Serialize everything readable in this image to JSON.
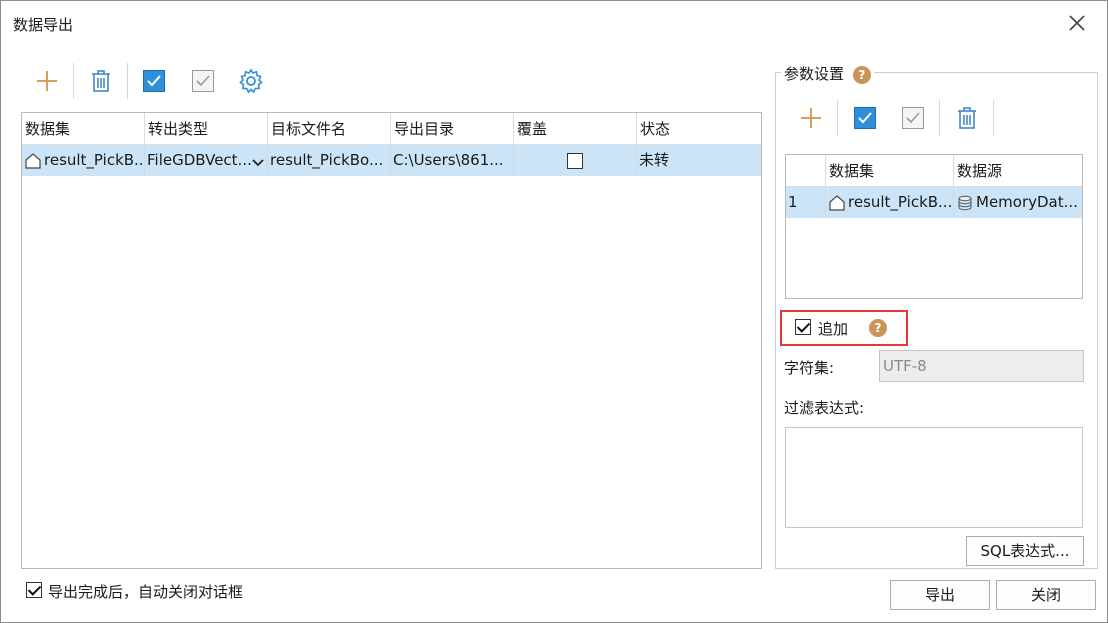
{
  "window": {
    "title": "数据导出"
  },
  "toolbar": {
    "add": "add-icon",
    "delete": "trash-icon",
    "select_all": "check-all-icon",
    "select_invert": "check-invert-icon",
    "settings": "gear-icon"
  },
  "table": {
    "columns": [
      "数据集",
      "转出类型",
      "目标文件名",
      "导出目录",
      "覆盖",
      "状态"
    ],
    "rows": [
      {
        "dataset": "result_PickB...",
        "type": "FileGDBVect...",
        "filename": "result_PickBo...",
        "dir": "C:\\Users\\861...",
        "overwrite": false,
        "status": "未转"
      }
    ]
  },
  "params": {
    "title": "参数设置",
    "help": "?",
    "columns": [
      "",
      "数据集",
      "数据源"
    ],
    "rows": [
      {
        "index": "1",
        "dataset": "result_PickB...",
        "source": "MemoryDat..."
      }
    ],
    "append_label": "追加",
    "append_checked": true,
    "charset_label": "字符集:",
    "charset_value": "UTF-8",
    "filter_label": "过滤表达式:",
    "filter_value": "",
    "sql_button": "SQL表达式..."
  },
  "footer": {
    "auto_close_label": "导出完成后，自动关闭对话框",
    "auto_close_checked": true,
    "export_button": "导出",
    "close_button": "关闭"
  },
  "colors": {
    "accent": "#2f8fd8",
    "selected_row": "#cce4f7",
    "add_icon": "#d6a05c",
    "highlight_box": "#e53935"
  }
}
